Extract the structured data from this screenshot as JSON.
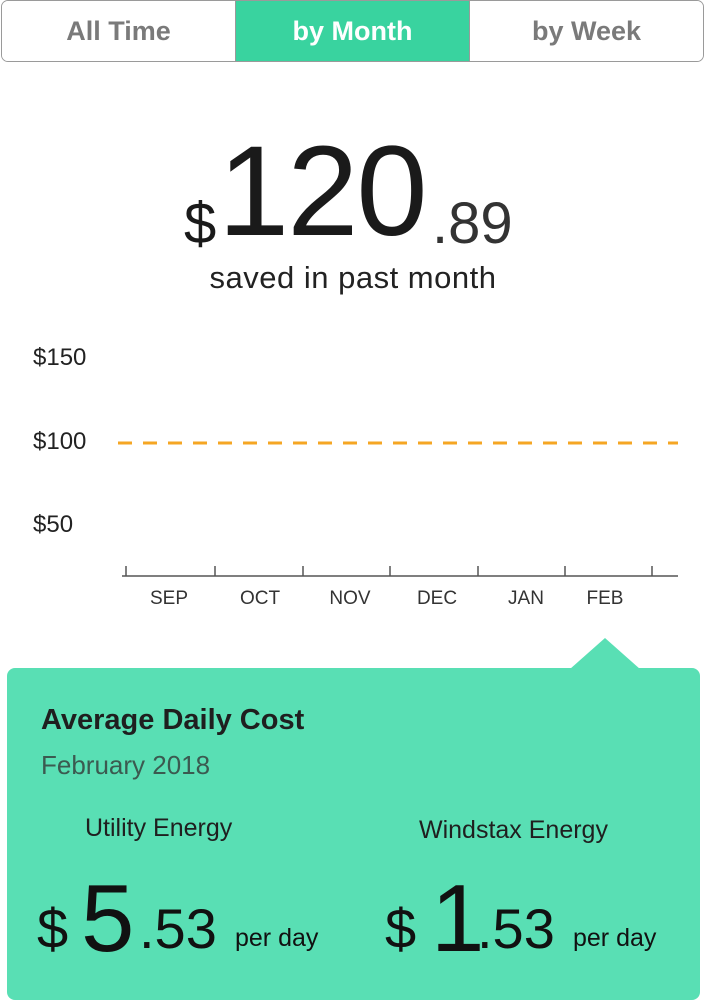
{
  "tabs": [
    {
      "label": "All Time",
      "active": false
    },
    {
      "label": "by Month",
      "active": true
    },
    {
      "label": "by Week",
      "active": false
    }
  ],
  "summary": {
    "currency": "$",
    "whole": "120",
    "cents": ".89",
    "caption": "saved in past month"
  },
  "chart_data": {
    "type": "line",
    "categories": [
      "SEP",
      "OCT",
      "NOV",
      "DEC",
      "JAN",
      "FEB"
    ],
    "y_ticks": [
      "$150",
      "$100",
      "$50"
    ],
    "reference_line": {
      "value": 100,
      "style": "dashed",
      "color": "#f5a623"
    },
    "series": []
  },
  "card": {
    "title": "Average Daily Cost",
    "period": "February 2018",
    "utility": {
      "label": "Utility Energy",
      "currency": "$",
      "whole": "5",
      "cents": ".53",
      "unit": "per day"
    },
    "windstax": {
      "label": "Windstax Energy",
      "currency": "$",
      "whole": "1",
      "cents": ".53",
      "unit": "per day"
    }
  },
  "colors": {
    "accent": "#39d39f",
    "card": "#59dfb4",
    "reference": "#f5a623"
  }
}
